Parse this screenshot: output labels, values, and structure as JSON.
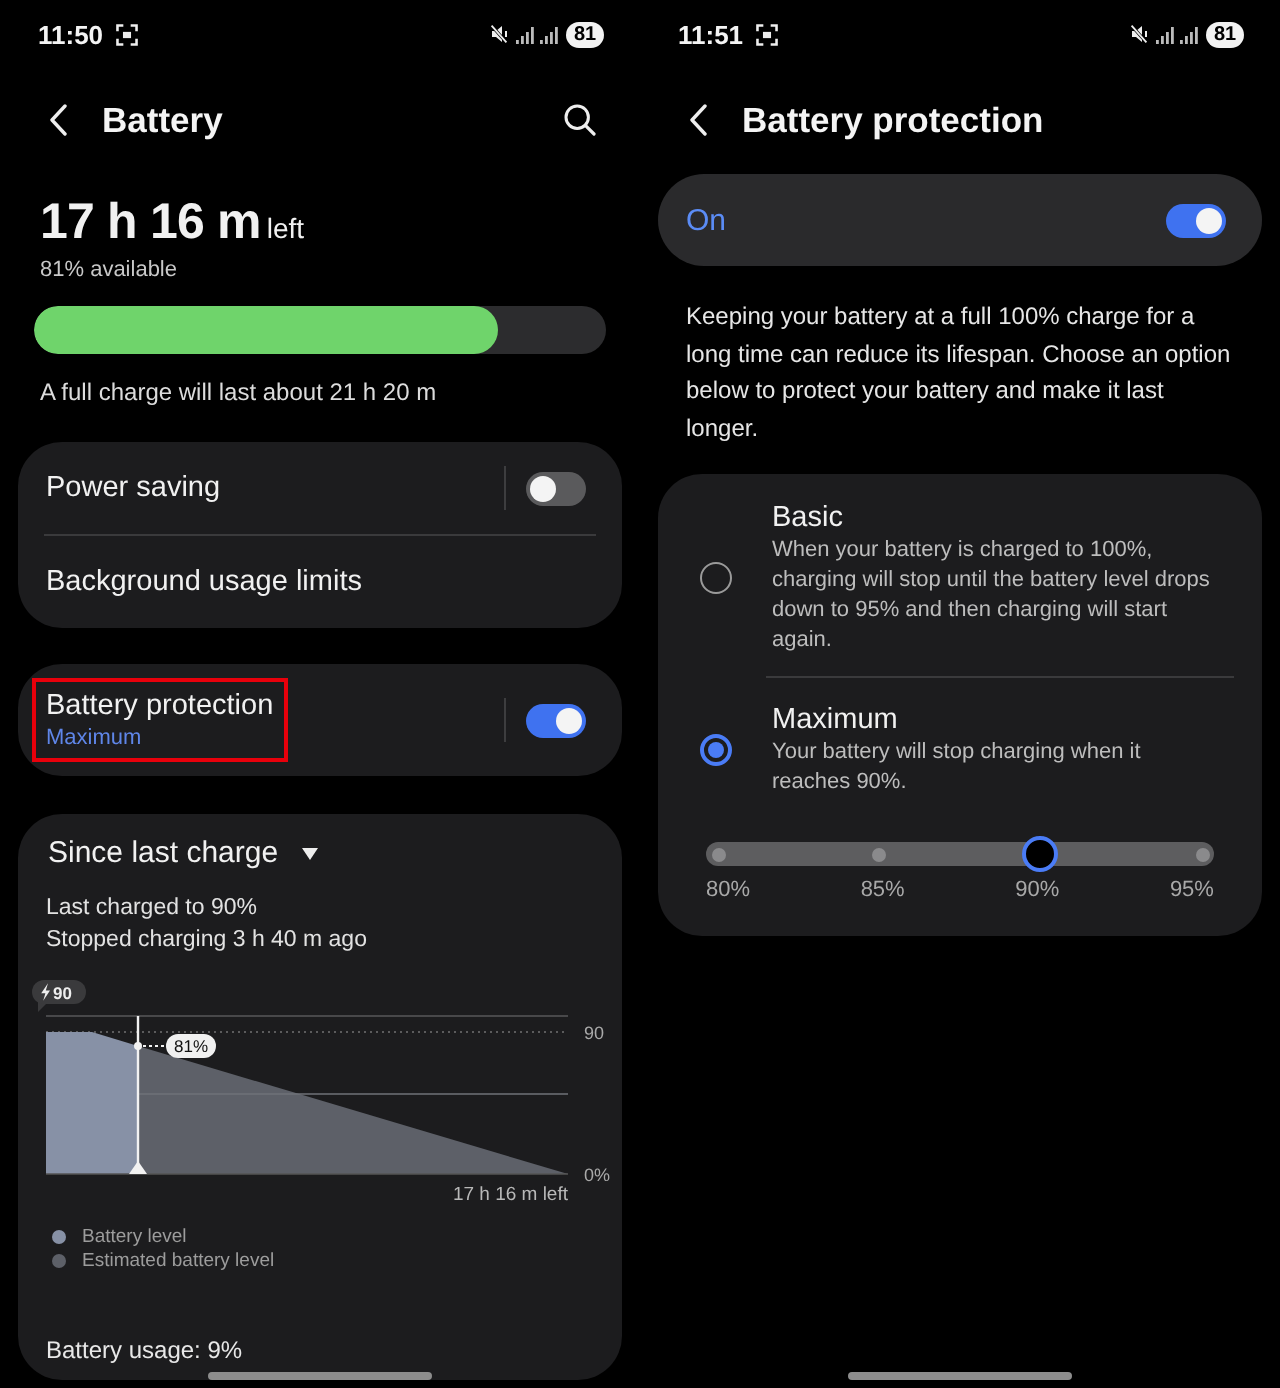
{
  "battery_screen": {
    "status_bar": {
      "time": "11:50",
      "battery": "81"
    },
    "title": "Battery",
    "summary": {
      "time_left": "17 h 16 m",
      "time_left_suffix": "left",
      "available": "81% available",
      "level": 0.81,
      "full_charge": "A full charge will last about 21 h 20 m"
    },
    "setting_groups": [
      {
        "items": [
          {
            "kind": "toggle",
            "label": "Power saving",
            "on": false,
            "highlighted": false
          },
          {
            "kind": "link",
            "label": "Background usage limits",
            "highlighted": false
          }
        ]
      },
      {
        "items": [
          {
            "kind": "toggle",
            "label": "Battery protection",
            "sublabel": "Maximum",
            "on": true,
            "highlighted": true
          }
        ]
      }
    ],
    "usage": {
      "period": "Since last charge",
      "last_charged": "Last charged to 90%",
      "stopped": "Stopped charging 3 h 40 m ago",
      "chart": {
        "charge_limit": "90",
        "y_top_label": "90",
        "y_bottom_label": "0%",
        "current_level": "81%",
        "time_left": "17 h 16 m left"
      },
      "legend": [
        {
          "label": "Battery level",
          "color": "#8791a6"
        },
        {
          "label": "Estimated battery level",
          "color": "#5d6068"
        }
      ],
      "total": "Battery usage: 9%"
    }
  },
  "protection_screen": {
    "status_bar": {
      "time": "11:51",
      "battery": "81"
    },
    "title": "Battery protection",
    "master_switch": {
      "label": "On",
      "on": true
    },
    "description": "Keeping your battery at a full 100% charge for a long time can reduce its lifespan. Choose an option below to protect your battery and make it last longer.",
    "options": [
      {
        "title": "Basic",
        "description": "When your battery is charged to 100%, charging will stop until the battery level drops down to 95% and then charging will start again.",
        "selected": false
      },
      {
        "title": "Maximum",
        "description": "Your battery will stop charging when it reaches 90%.",
        "selected": true
      }
    ],
    "limit_slider": {
      "level": 0.667,
      "stops": [
        "80%",
        "85%",
        "90%",
        "95%"
      ]
    }
  }
}
